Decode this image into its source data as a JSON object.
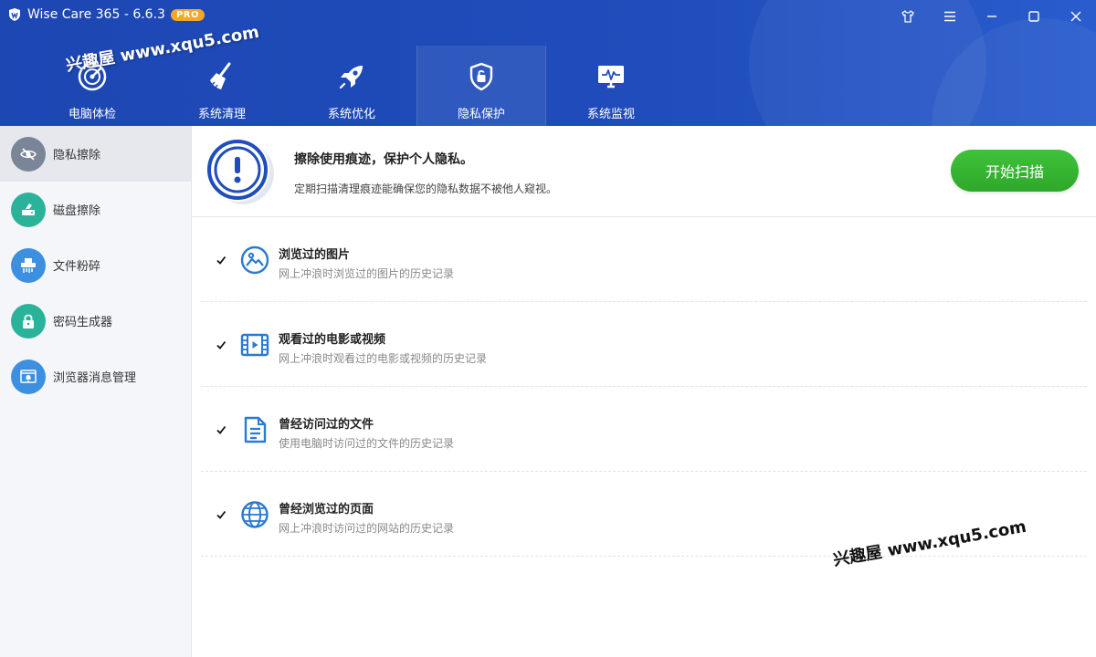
{
  "app": {
    "title": "Wise Care 365 - 6.6.3",
    "badge": "PRO"
  },
  "nav": {
    "items": [
      {
        "label": "电脑体检",
        "icon": "radar-icon"
      },
      {
        "label": "系统清理",
        "icon": "broom-icon"
      },
      {
        "label": "系统优化",
        "icon": "rocket-icon"
      },
      {
        "label": "隐私保护",
        "icon": "shield-lock-icon"
      },
      {
        "label": "系统监视",
        "icon": "monitor-pulse-icon"
      }
    ],
    "active_index": 3
  },
  "sidebar": {
    "items": [
      {
        "label": "隐私擦除",
        "icon": "eye-slash-icon",
        "color": "#7a8597"
      },
      {
        "label": "磁盘擦除",
        "icon": "disk-eraser-icon",
        "color": "#2bb39a"
      },
      {
        "label": "文件粉碎",
        "icon": "shredder-icon",
        "color": "#3d8fe0"
      },
      {
        "label": "密码生成器",
        "icon": "lock-icon",
        "color": "#2bb39a"
      },
      {
        "label": "浏览器消息管理",
        "icon": "browser-bell-icon",
        "color": "#3d8fe0"
      }
    ],
    "active_index": 0
  },
  "banner": {
    "title": "擦除使用痕迹，保护个人隐私。",
    "description": "定期扫描清理痕迹能确保您的隐私数据不被他人窥视。",
    "scan_button": "开始扫描"
  },
  "privacy_items": [
    {
      "title": "浏览过的图片",
      "description": "网上冲浪时浏览过的图片的历史记录",
      "checked": true,
      "icon": "image-icon"
    },
    {
      "title": "观看过的电影或视频",
      "description": "网上冲浪时观看过的电影或视频的历史记录",
      "checked": true,
      "icon": "film-icon"
    },
    {
      "title": "曾经访问过的文件",
      "description": "使用电脑时访问过的文件的历史记录",
      "checked": true,
      "icon": "document-icon"
    },
    {
      "title": "曾经浏览过的页面",
      "description": "网上冲浪时访问过的网站的历史记录",
      "checked": true,
      "icon": "globe-icon"
    }
  ],
  "watermark": "兴趣屋 www.xqu5.com",
  "colors": {
    "header": "#1f4dbb",
    "accent": "#2a7ad1",
    "scan_button": "#35b52f"
  }
}
